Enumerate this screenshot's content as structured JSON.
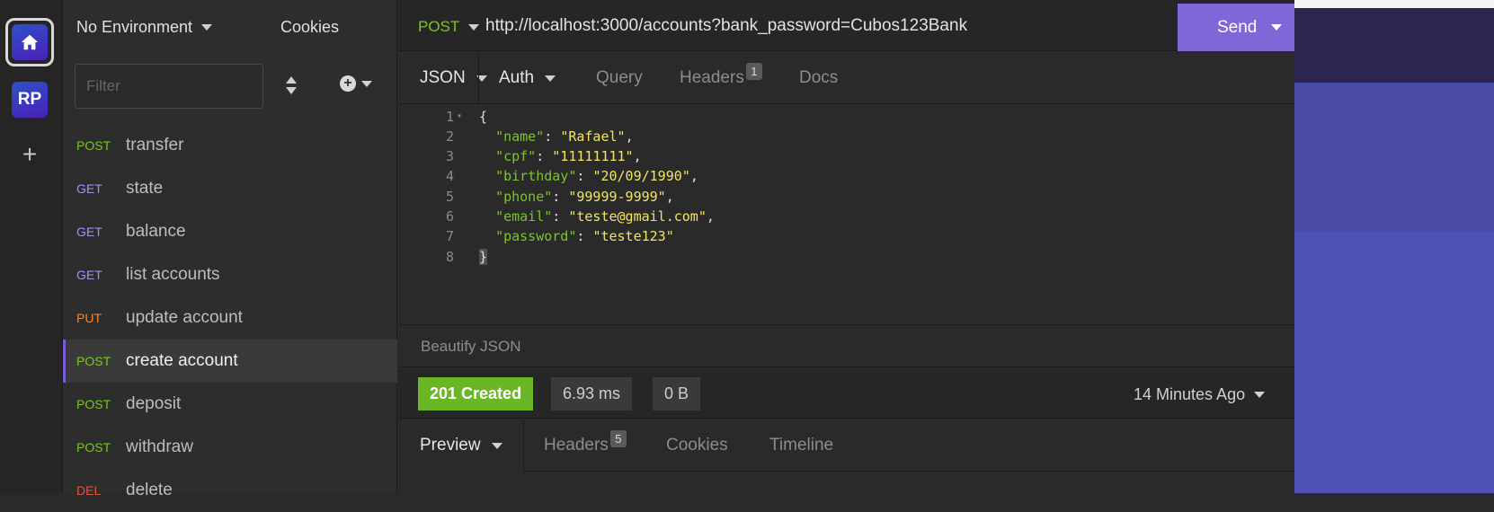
{
  "sidebar": {
    "workspace_initials": "RP",
    "environment": "No Environment",
    "cookies": "Cookies",
    "filter_placeholder": "Filter",
    "requests": [
      {
        "method": "POST",
        "name": "transfer"
      },
      {
        "method": "GET",
        "name": "state"
      },
      {
        "method": "GET",
        "name": "balance"
      },
      {
        "method": "GET",
        "name": "list accounts"
      },
      {
        "method": "PUT",
        "name": "update account"
      },
      {
        "method": "POST",
        "name": "create account",
        "active": true
      },
      {
        "method": "POST",
        "name": "deposit"
      },
      {
        "method": "POST",
        "name": "withdraw"
      },
      {
        "method": "DEL",
        "name": "delete"
      }
    ]
  },
  "request": {
    "method": "POST",
    "url": "http://localhost:3000/accounts?bank_password=Cubos123Bank",
    "send_label": "Send",
    "tabs": {
      "body": "JSON",
      "auth": "Auth",
      "query": "Query",
      "headers": "Headers",
      "headers_count": "1",
      "docs": "Docs"
    },
    "body_lines": [
      {
        "n": "1",
        "key": "",
        "val": "",
        "raw": "{"
      },
      {
        "n": "2",
        "key": "\"name\"",
        "val": "\"Rafael\"",
        "comma": ","
      },
      {
        "n": "3",
        "key": "\"cpf\"",
        "val": "\"11111111\"",
        "comma": ","
      },
      {
        "n": "4",
        "key": "\"birthday\"",
        "val": "\"20/09/1990\"",
        "comma": ","
      },
      {
        "n": "5",
        "key": "\"phone\"",
        "val": "\"99999-9999\"",
        "comma": ","
      },
      {
        "n": "6",
        "key": "\"email\"",
        "val": "\"teste@gmail.com\"",
        "comma": ","
      },
      {
        "n": "7",
        "key": "\"password\"",
        "val": "\"teste123\"",
        "comma": ""
      },
      {
        "n": "8",
        "key": "",
        "val": "",
        "raw": "}"
      }
    ],
    "beautify": "Beautify JSON"
  },
  "response": {
    "status": "201 Created",
    "time": "6.93 ms",
    "size": "0 B",
    "when": "14 Minutes Ago",
    "tabs": {
      "preview": "Preview",
      "headers": "Headers",
      "headers_count": "5",
      "cookies": "Cookies",
      "timeline": "Timeline"
    }
  },
  "colors": {
    "accent": "#7e68d8",
    "post": "#7ec32a",
    "get": "#a38ef7",
    "put": "#f0893a",
    "delete": "#e8513c",
    "status_ok": "#6ab624"
  }
}
